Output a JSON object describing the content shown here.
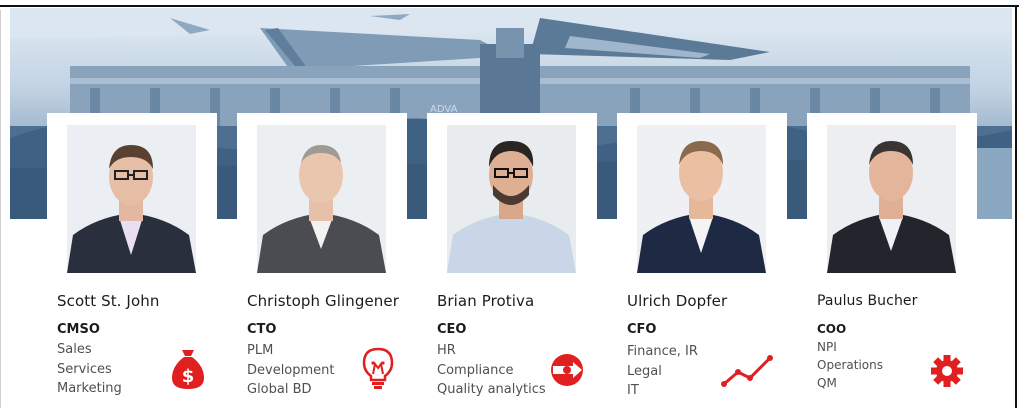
{
  "accent_color": "#e02020",
  "banner": {
    "sign_text": "ADVA"
  },
  "people": [
    {
      "name": "Scott St. John",
      "role": "CMSO",
      "areas": [
        "Sales",
        "Services",
        "Marketing"
      ],
      "icon": "money-bag-icon"
    },
    {
      "name": "Christoph Glingener",
      "role": "CTO",
      "areas": [
        "PLM",
        "Development",
        "Global BD"
      ],
      "icon": "lightbulb-icon"
    },
    {
      "name": "Brian Protiva",
      "role": "CEO",
      "areas": [
        "HR",
        "Compliance",
        "Quality analytics"
      ],
      "icon": "target-arrow-icon"
    },
    {
      "name": "Ulrich Dopfer",
      "role": "CFO",
      "areas": [
        "Finance, IR",
        "Legal",
        "IT"
      ],
      "icon": "trend-line-icon"
    },
    {
      "name": "Paulus Bucher",
      "role": "COO",
      "areas": [
        "NPI",
        "Operations",
        "QM"
      ],
      "icon": "gear-icon"
    }
  ]
}
